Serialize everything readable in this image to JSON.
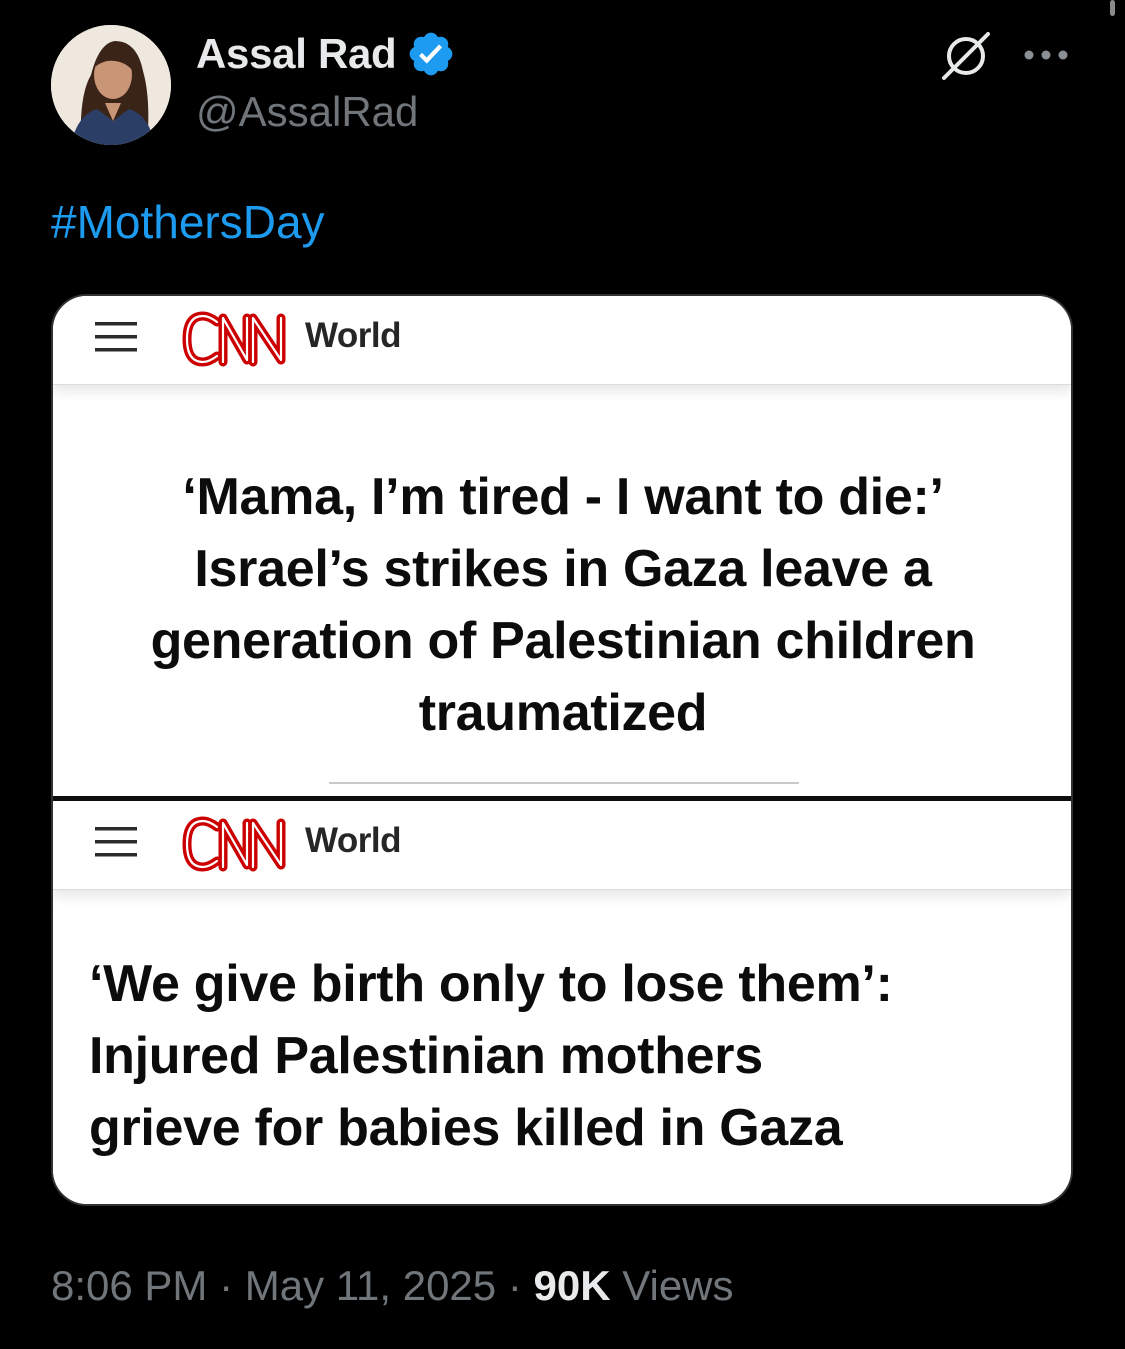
{
  "author": {
    "display_name": "Assal Rad",
    "handle": "@AssalRad",
    "verified": true
  },
  "tweet": {
    "hashtag": "#MothersDay"
  },
  "media": {
    "top_panel": {
      "brand": "CNN",
      "section": "World",
      "headline_lines": [
        "‘Mama, I’m tired - I want to die:’",
        "Israel’s strikes in Gaza leave a",
        "generation of Palestinian children",
        "traumatized"
      ]
    },
    "bottom_panel": {
      "brand": "CNN",
      "section": "World",
      "headline_lines": [
        "‘We give birth only to lose them’:",
        "Injured Palestinian mothers",
        "grieve for babies killed in Gaza"
      ]
    }
  },
  "meta": {
    "time": "8:06 PM",
    "separator": "·",
    "date": "May 11, 2025",
    "views_count": "90K",
    "views_label": "Views"
  },
  "icons": {
    "verified": "verified-badge-icon",
    "grok": "grok-icon",
    "more": "more-icon",
    "menu": "hamburger-icon"
  },
  "colors": {
    "background": "#000000",
    "primary_text": "#e7e9ea",
    "secondary_text": "#71767b",
    "link": "#1d9bf0",
    "cnn_red": "#cc0000"
  }
}
